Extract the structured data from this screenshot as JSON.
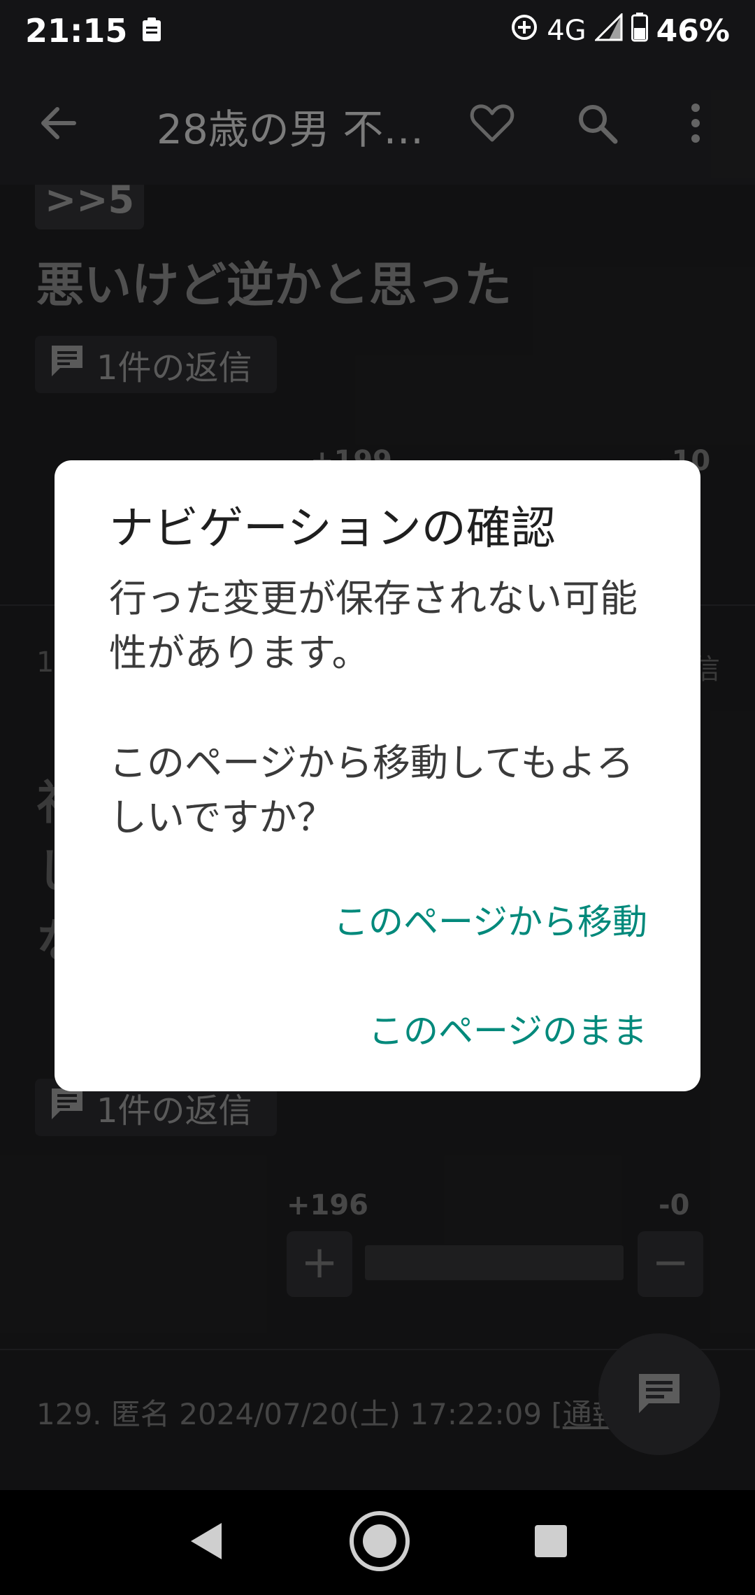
{
  "status_bar": {
    "time": "21:15",
    "network": "4G",
    "battery": "46%"
  },
  "app_bar": {
    "title": "28歳の男 不…"
  },
  "thread": {
    "post1": {
      "anchor": ">>5",
      "body": "悪いけど逆かと思った",
      "reply_count": "1件の返信",
      "plus_votes": "+199",
      "minus_votes": "-10"
    },
    "post2": {
      "number_peek": "1",
      "reply_peek": "信",
      "body_peek": [
        "礼",
        "し",
        "な"
      ],
      "reply_count": "1件の返信",
      "plus_votes": "+196",
      "minus_votes": "-0"
    },
    "post3": {
      "meta": "129. 匿名 2024/07/20(土) 17:22:09",
      "report": "通報"
    }
  },
  "dialog": {
    "title": "ナビゲーションの確認",
    "message": "行った変更が保存されない可能性があります。\n\nこのページから移動してもよろしいですか？",
    "leave_label": "このページから移動",
    "stay_label": "このページのまま"
  },
  "colors": {
    "accent": "#00897b",
    "background": "#1b1b1d",
    "dialog": "#ffffff"
  },
  "icons": {
    "back": "arrow-left-icon",
    "favorite": "heart-outline-icon",
    "search": "search-icon",
    "more": "more-vert-icon",
    "comment": "comment-icon",
    "clipboard": "clipboard-icon",
    "nav_back": "triangle-back-icon",
    "nav_home": "circle-home-icon",
    "nav_recents": "square-recents-icon"
  }
}
